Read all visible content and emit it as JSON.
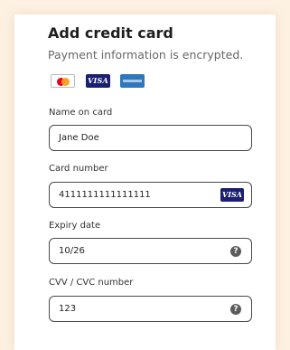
{
  "header": {
    "title": "Add credit card",
    "subtitle": "Payment information is encrypted."
  },
  "card_logos": [
    {
      "name": "mastercard-icon",
      "label": ""
    },
    {
      "name": "visa-icon",
      "label": "VISA"
    },
    {
      "name": "amex-icon",
      "label": ""
    }
  ],
  "fields": {
    "name_on_card": {
      "label": "Name on card",
      "value": "Jane Doe"
    },
    "card_number": {
      "label": "Card number",
      "value": "4111111111111111",
      "brand_icon": "VISA"
    },
    "expiry_date": {
      "label": "Expiry date",
      "value": "10/26",
      "help_icon": "?"
    },
    "cvv": {
      "label": "CVV / CVC number",
      "value": "123",
      "help_icon": "?"
    }
  },
  "colors": {
    "page_background": "#fdf1e2",
    "visa_blue": "#1a1f71",
    "amex_blue": "#2e77bb",
    "mastercard_red": "#eb001b",
    "mastercard_orange": "#f79e1b"
  }
}
